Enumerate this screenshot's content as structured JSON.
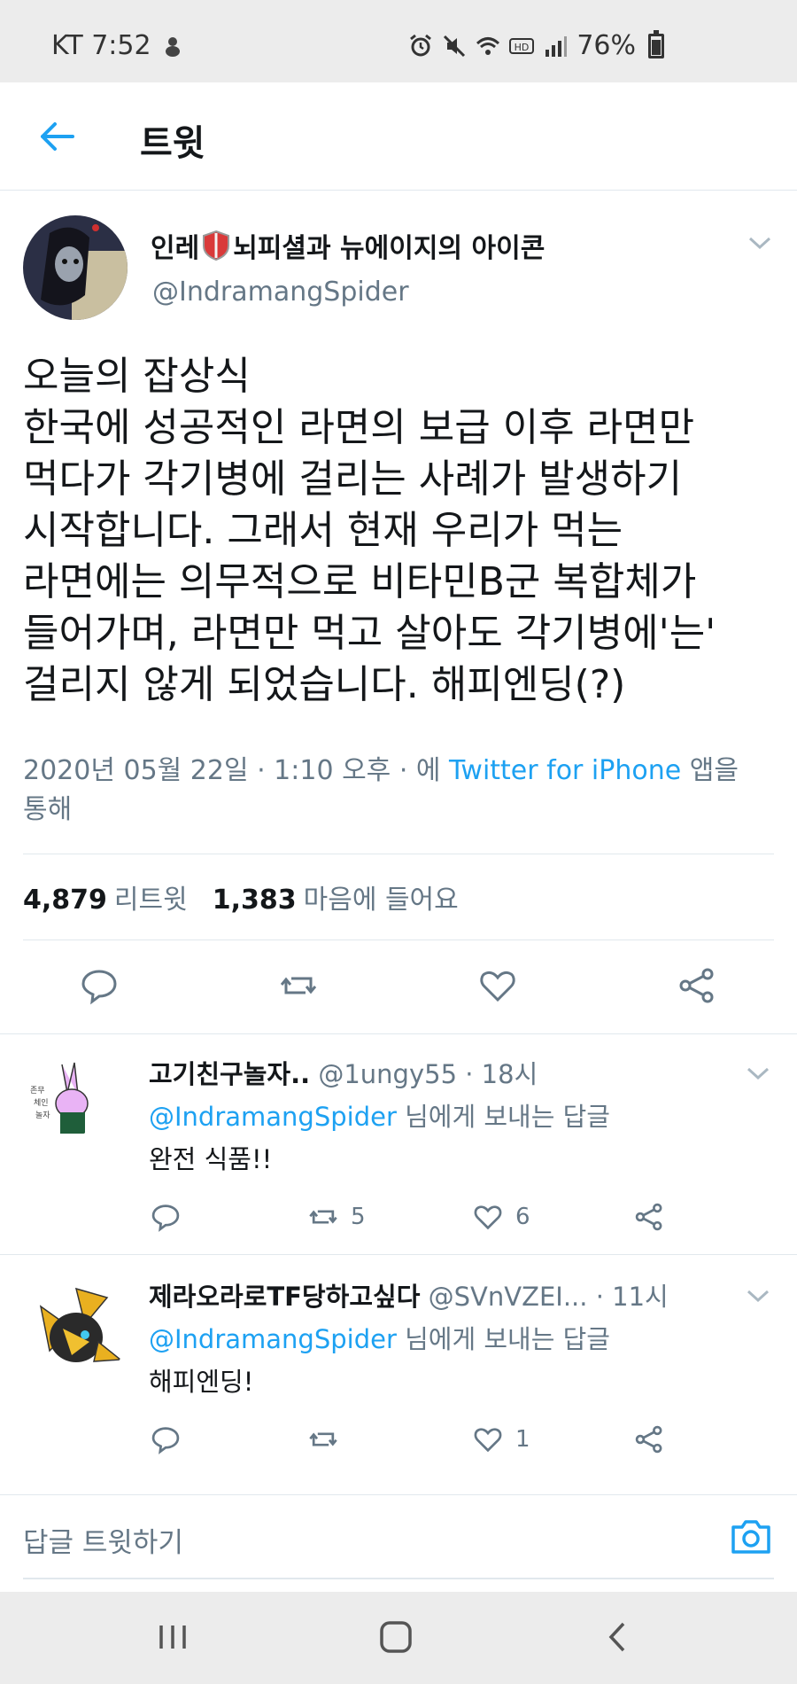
{
  "status_bar": {
    "carrier_time": "KT 7:52",
    "battery": "76%",
    "battery_level": 0.76
  },
  "header": {
    "title": "트윗"
  },
  "tweet": {
    "name_part1": "인레",
    "name_part2": "뇌피셜과 뉴에이지의 아이콘",
    "handle": "@IndramangSpider",
    "lines": [
      "오늘의 잡상식",
      "한국에 성공적인 라면의 보급 이후 라면만",
      "먹다가 각기병에 걸리는 사례가 발생하기",
      "시작합니다. 그래서 현재 우리가 먹는",
      "라면에는 의무적으로 비타민B군 복합체가",
      "들어가며, 라면만 먹고 살아도 각기병에'는'",
      "걸리지 않게 되었습니다. 해피엔딩(?)"
    ],
    "date": "2020년 05월 22일 · 1:10 오후 · 에",
    "source": "Twitter for iPhone",
    "source_suffix": "앱을",
    "source_suffix2": "통해",
    "retweets_count": "4,879",
    "retweets_label": "리트윗",
    "likes_count": "1,383",
    "likes_label": "마음에 들어요"
  },
  "replies": [
    {
      "name": "고기친구놀자..",
      "handle": "@1ungy55 · 18시",
      "reply_to": "@IndramangSpider",
      "reply_to_suffix": " 님에게 보내는 답글",
      "text": "완전 식품!!",
      "retweets": "5",
      "likes": "6"
    },
    {
      "name": "제라오라로TF당하고싶다",
      "handle": "@SVnVZEI...",
      "time": "· 11시",
      "reply_to": "@IndramangSpider",
      "reply_to_suffix": " 님에게 보내는 답글",
      "text": "해피엔딩!",
      "retweets": "",
      "likes": "1"
    }
  ],
  "compose": {
    "placeholder": "답글 트윗하기"
  },
  "colors": {
    "accent": "#1da1f2",
    "secondary_text": "#657786",
    "divider": "#e1e8ed"
  },
  "icons": [
    "back-arrow-icon",
    "reply-icon",
    "retweet-icon",
    "like-icon",
    "share-icon",
    "camera-icon",
    "chevron-down-icon"
  ]
}
